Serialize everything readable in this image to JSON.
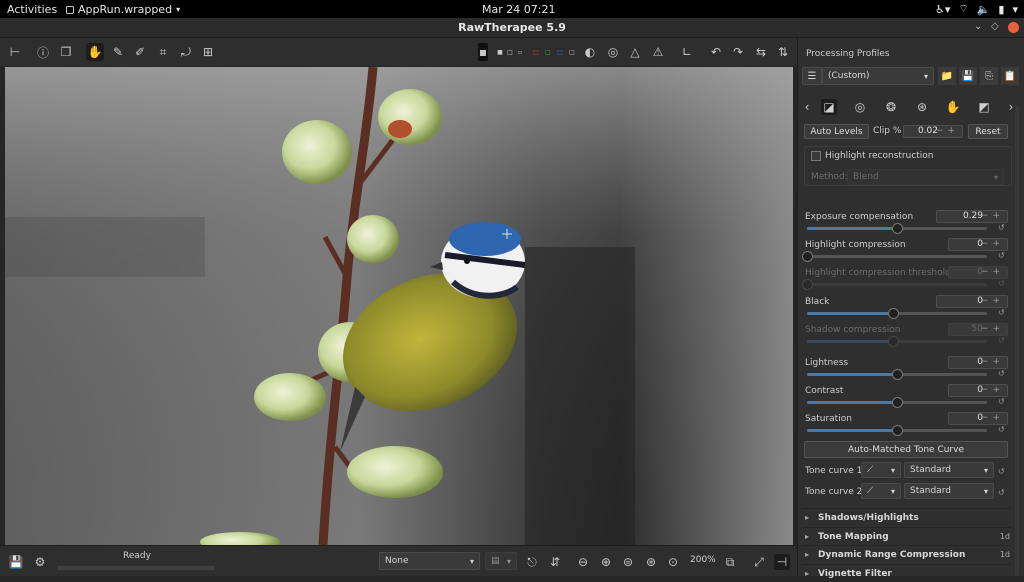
{
  "system_bar": {
    "activities": "Activities",
    "app_name": "AppRun.wrapped",
    "clock": "Mar 24  07:21"
  },
  "window": {
    "title": "RawTherapee 5.9"
  },
  "status": {
    "text": "Ready",
    "zoom": "200%"
  },
  "bottom": {
    "color_profile": "None"
  },
  "panel": {
    "processing_profiles_label": "Processing Profiles",
    "profile_value": "(Custom)",
    "auto_levels": "Auto Levels",
    "clip_label": "Clip %",
    "clip_value": "0.02",
    "reset": "Reset",
    "highlight_reconstruction": "Highlight reconstruction",
    "method_label": "Method:",
    "method_value": "Blend",
    "sliders": [
      {
        "label": "Exposure compensation",
        "value": "0.29",
        "level": 0.5,
        "enabled": true
      },
      {
        "label": "Highlight compression",
        "value": "0",
        "level": 0.0,
        "enabled": true
      },
      {
        "label": "Highlight compression threshold",
        "value": "0",
        "level": 0.0,
        "enabled": false
      },
      {
        "label": "Black",
        "value": "0",
        "level": 0.48,
        "enabled": true
      },
      {
        "label": "Shadow compression",
        "value": "50",
        "level": 0.48,
        "enabled": false
      },
      {
        "label": "Lightness",
        "value": "0",
        "level": 0.5,
        "enabled": true
      },
      {
        "label": "Contrast",
        "value": "0",
        "level": 0.5,
        "enabled": true
      },
      {
        "label": "Saturation",
        "value": "0",
        "level": 0.5,
        "enabled": true
      }
    ],
    "auto_matched_tone_curve": "Auto-Matched Tone Curve",
    "tone_curve_1": {
      "label": "Tone curve 1:",
      "mode": "Standard"
    },
    "tone_curve_2": {
      "label": "Tone curve 2:",
      "mode": "Standard"
    },
    "sections": [
      {
        "label": "Shadows/Highlights",
        "badge": ""
      },
      {
        "label": "Tone Mapping",
        "badge": "1d"
      },
      {
        "label": "Dynamic Range Compression",
        "badge": "1d"
      },
      {
        "label": "Vignette Filter",
        "badge": ""
      }
    ]
  },
  "colors": {
    "accent": "#4a78a8",
    "close": "#e9613d",
    "panel": "#2f2f2f"
  }
}
